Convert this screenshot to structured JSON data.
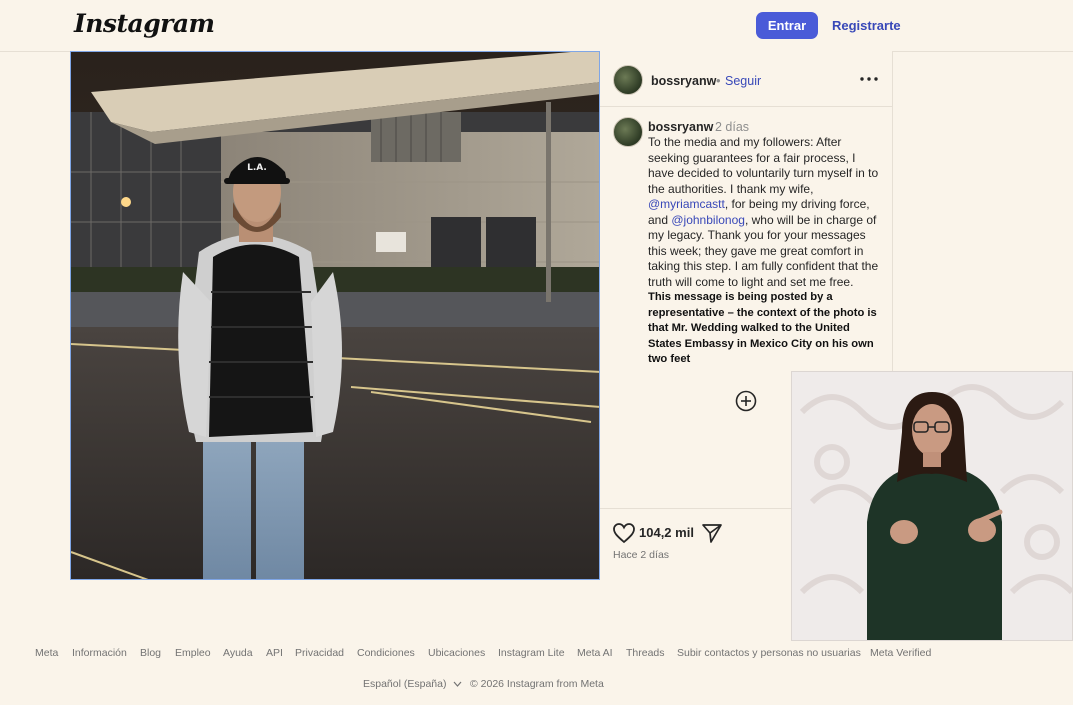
{
  "header": {
    "logo_text": "Instagram",
    "login_label": "Entrar",
    "register_label": "Registrarte",
    "accent_color": "#4a5bd8"
  },
  "post": {
    "username": "bossryanw",
    "follow_label": "Seguir",
    "separator": "•",
    "caption_username": "bossryanw",
    "caption_time": "2 días",
    "caption_parts": [
      "To the media and my followers: After seeking guarantees for a fair process, I have decided to voluntarily turn myself in to the authorities. I thank my wife, ",
      "@myriamcastt",
      ", for being my driving force, and ",
      "@johnbilonog",
      ", who will be in charge of my legacy. Thank you for your messages this week; they gave me great comfort in taking this step. I am fully confident that the truth will come to light and set me free."
    ],
    "caption_bold": "This message is being posted by a representative – the context of the photo is that Mr. Wedding walked to the United States Embassy in Mexico City on his own two feet",
    "likes": "104,2 mil",
    "time_ago": "Hace 2 días",
    "hat_text": "L.A."
  },
  "footer": {
    "links": [
      "Meta",
      "Información",
      "Blog",
      "Empleo",
      "Ayuda",
      "API",
      "Privacidad",
      "Condiciones",
      "Ubicaciones",
      "Instagram Lite",
      "Meta AI",
      "Threads",
      "Subir contactos y personas no usuarias",
      "Meta Verified"
    ],
    "language": "Español (España)",
    "copyright": "© 2026 Instagram from Meta"
  },
  "icons": [
    "more-options-icon",
    "add-comment-icon",
    "heart-icon",
    "share-icon",
    "chevron-down-icon"
  ]
}
